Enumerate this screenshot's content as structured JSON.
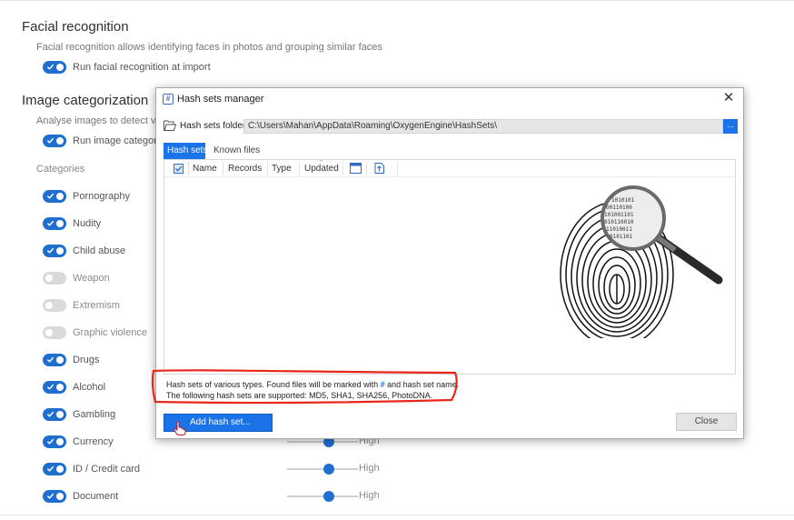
{
  "settings": {
    "facial": {
      "title": "Facial recognition",
      "description": "Facial recognition allows identifying faces in photos and grouping similar faces",
      "run_label": "Run facial recognition at import",
      "run_enabled": true
    },
    "image_cat": {
      "title": "Image categorization",
      "description": "Analyse images to detect vis",
      "run_label": "Run image categor",
      "run_enabled": true
    },
    "categories_label": "Categories",
    "categories": [
      {
        "label": "Pornography",
        "enabled": true
      },
      {
        "label": "Nudity",
        "enabled": true
      },
      {
        "label": "Child abuse",
        "enabled": true
      },
      {
        "label": "Weapon",
        "enabled": false
      },
      {
        "label": "Extremism",
        "enabled": false
      },
      {
        "label": "Graphic violence",
        "enabled": false
      },
      {
        "label": "Drugs",
        "enabled": true
      },
      {
        "label": "Alcohol",
        "enabled": true
      },
      {
        "label": "Gambling",
        "enabled": true
      },
      {
        "label": "Currency",
        "enabled": true,
        "level": "High",
        "slider_value": 0.6
      },
      {
        "label": "ID / Credit card",
        "enabled": true,
        "level": "High",
        "slider_value": 0.6
      },
      {
        "label": "Document",
        "enabled": true,
        "level": "High",
        "slider_value": 0.6
      }
    ]
  },
  "dialog": {
    "title": "Hash sets manager",
    "folder_label": "Hash sets folder",
    "folder_path": "C:\\Users\\Mahan\\AppData\\Roaming\\OxygenEngine\\HashSets\\",
    "browse_label": "...",
    "tabs": [
      {
        "label": "Hash sets",
        "active": true
      },
      {
        "label": "Known files",
        "active": false
      }
    ],
    "columns": [
      "Name",
      "Records",
      "Type",
      "Updated"
    ],
    "info_line1_a": "Hash sets of various types. Found files will be marked with ",
    "info_hash_symbol": "#",
    "info_line1_b": " and hash set name.",
    "info_line2": "The following hash sets are supported: MD5, SHA1, SHA256, PhotoDNA.",
    "add_button": "Add hash set...",
    "close_button": "Close"
  },
  "colors": {
    "accent": "#1a73e8",
    "toggle_on": "#1f6fd1",
    "toggle_off": "#dadada",
    "annotation": "#e8261c"
  }
}
